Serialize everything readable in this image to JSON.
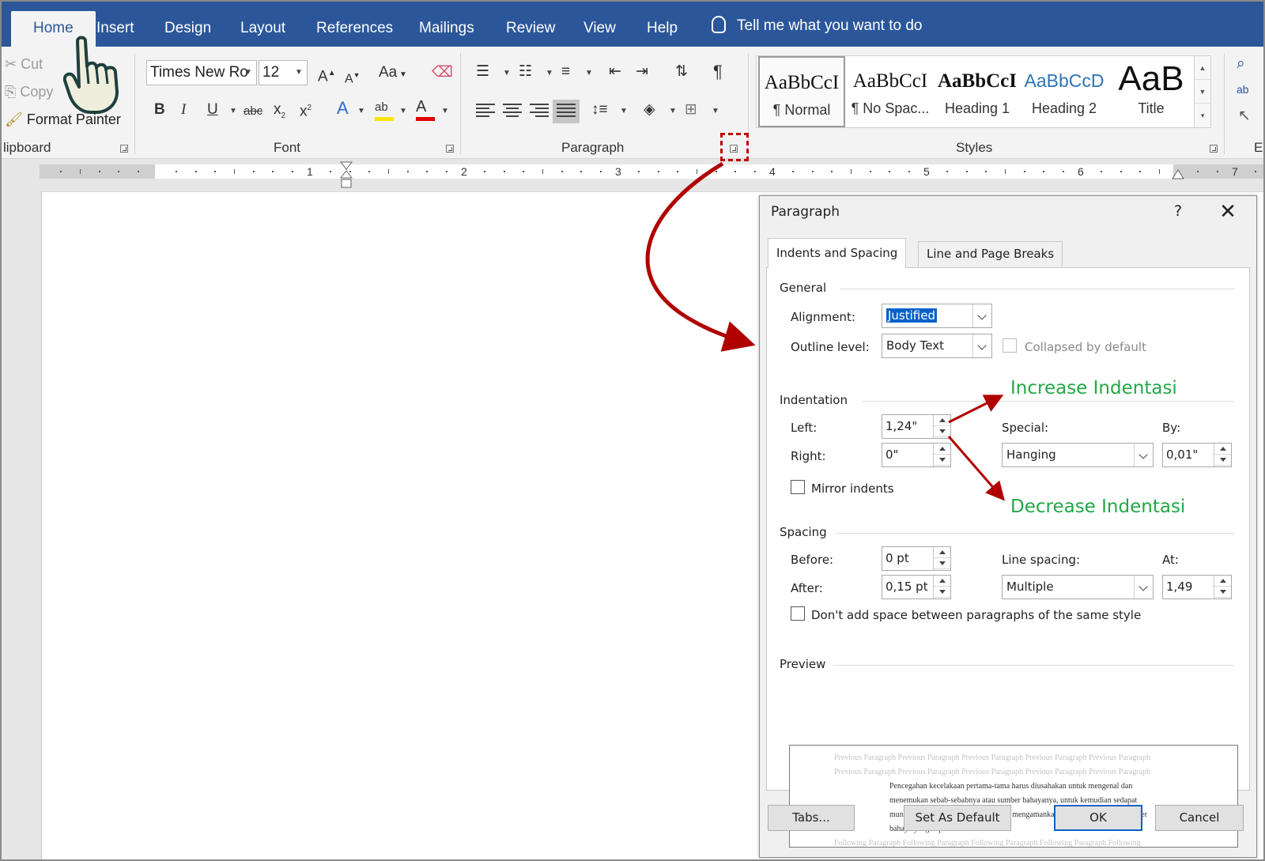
{
  "ribbon_tabs": [
    "Home",
    "Insert",
    "Design",
    "Layout",
    "References",
    "Mailings",
    "Review",
    "View",
    "Help"
  ],
  "tell_me": "Tell me what you want to do",
  "clipboard": {
    "cut": "Cut",
    "copy": "Copy",
    "format_painter": "Format Painter",
    "group_label": "lipboard"
  },
  "font": {
    "name": "Times New Ro",
    "size": "12",
    "group_label": "Font",
    "change_case": "Aa",
    "bold": "B",
    "italic": "I",
    "underline": "U",
    "strike": "abc",
    "sub": "x",
    "sup": "x"
  },
  "paragraph": {
    "group_label": "Paragraph",
    "pilcrow": "¶"
  },
  "styles": {
    "group_label": "Styles",
    "items": [
      {
        "sample": "AaBbCcI",
        "name": "¶ Normal"
      },
      {
        "sample": "AaBbCcI",
        "name": "¶ No Spac..."
      },
      {
        "sample": "AaBbCcI",
        "name": "Heading 1"
      },
      {
        "sample": "AaBbCcD",
        "name": "Heading 2"
      },
      {
        "sample": "AaB",
        "name": "Title"
      }
    ]
  },
  "editing_label": "E",
  "ruler_numbers": [
    "1",
    "2",
    "3",
    "4",
    "5",
    "6",
    "7"
  ],
  "dialog": {
    "title": "Paragraph",
    "help": "?",
    "close": "✕",
    "tabs": [
      "Indents and Spacing",
      "Line and Page Breaks"
    ],
    "general": {
      "heading": "General",
      "alignment_label": "Alignment:",
      "alignment_value": "Justified",
      "outline_label": "Outline level:",
      "outline_value": "Body Text",
      "collapsed_label": "Collapsed by default"
    },
    "indentation": {
      "heading": "Indentation",
      "left_label": "Left:",
      "left_value": "1,24\"",
      "right_label": "Right:",
      "right_value": "0\"",
      "special_label": "Special:",
      "special_value": "Hanging",
      "by_label": "By:",
      "by_value": "0,01\"",
      "mirror_label": "Mirror indents"
    },
    "spacing": {
      "heading": "Spacing",
      "before_label": "Before:",
      "before_value": "0 pt",
      "after_label": "After:",
      "after_value": "0,15 pt",
      "line_spacing_label": "Line spacing:",
      "line_spacing_value": "Multiple",
      "at_label": "At:",
      "at_value": "1,49",
      "dont_add_label": "Don't add space between paragraphs of the same style"
    },
    "preview": {
      "heading": "Preview",
      "prev_lines": [
        "Previous Paragraph Previous Paragraph Previous Paragraph Previous Paragraph Previous Paragraph",
        "Previous Paragraph Previous Paragraph Previous Paragraph Previous Paragraph Previous Paragraph"
      ],
      "sample_lines": [
        "Pencegahan kecelakaan pertama-tama harus diusahakan untuk mengenal dan",
        "menemukan sebab-sebabnya atau sumber bahayanya, untuk kemudian sedapat",
        "mungkin menghilangkan, mengindari, mengamankan dan mengendalikan sumber",
        "bahaya yang dapat timbul tersebut."
      ],
      "follow_line": "Following Paragraph Following Paragraph Following Paragraph Following Paragraph Following"
    },
    "buttons": {
      "tabs": "Tabs...",
      "set_default": "Set As Default",
      "ok": "OK",
      "cancel": "Cancel"
    }
  },
  "annotations": {
    "increase": "Increase Indentasi",
    "decrease": "Decrease Indentasi"
  },
  "colors": {
    "ribbon_blue": "#2b579a",
    "annotation_green": "#22a845",
    "arrow_red": "#b00000",
    "selection_blue": "#0a62c8"
  }
}
